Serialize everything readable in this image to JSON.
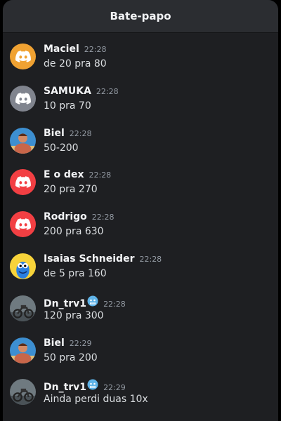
{
  "header": {
    "title": "Bate-papo"
  },
  "messages": [
    {
      "author": "Maciel",
      "time": "22:28",
      "text": "de 20 pra 80",
      "avatar": "discord-logo",
      "avatar_color": "#f0a232"
    },
    {
      "author": "SAMUKA",
      "time": "22:28",
      "text": "10 pra 70",
      "avatar": "discord-logo",
      "avatar_color": "#80848e"
    },
    {
      "author": "Biel",
      "time": "22:28",
      "text": "50-200",
      "avatar": "photo-man-beach"
    },
    {
      "author": "E o dex",
      "time": "22:28",
      "text": "20 pra 270",
      "avatar": "discord-logo",
      "avatar_color": "#f23f43"
    },
    {
      "author": "Rodrigo",
      "time": "22:28",
      "text": "200 pra 630",
      "avatar": "discord-logo",
      "avatar_color": "#f23f43"
    },
    {
      "author": "Isaias Schneider",
      "time": "22:28",
      "text": "de 5 pra 160",
      "avatar": "photo-blue-cartoon"
    },
    {
      "author": "Dn_trv1",
      "time": "22:28",
      "text": "120 pra 300",
      "avatar": "photo-motorbike",
      "name_emoji": "cold-face-emoji"
    },
    {
      "author": "Biel",
      "time": "22:29",
      "text": "50 pra 200",
      "avatar": "photo-man-beach"
    },
    {
      "author": "Dn_trv1",
      "time": "22:29",
      "text": "Ainda perdi duas 10x",
      "avatar": "photo-motorbike",
      "name_emoji": "cold-face-emoji"
    }
  ]
}
